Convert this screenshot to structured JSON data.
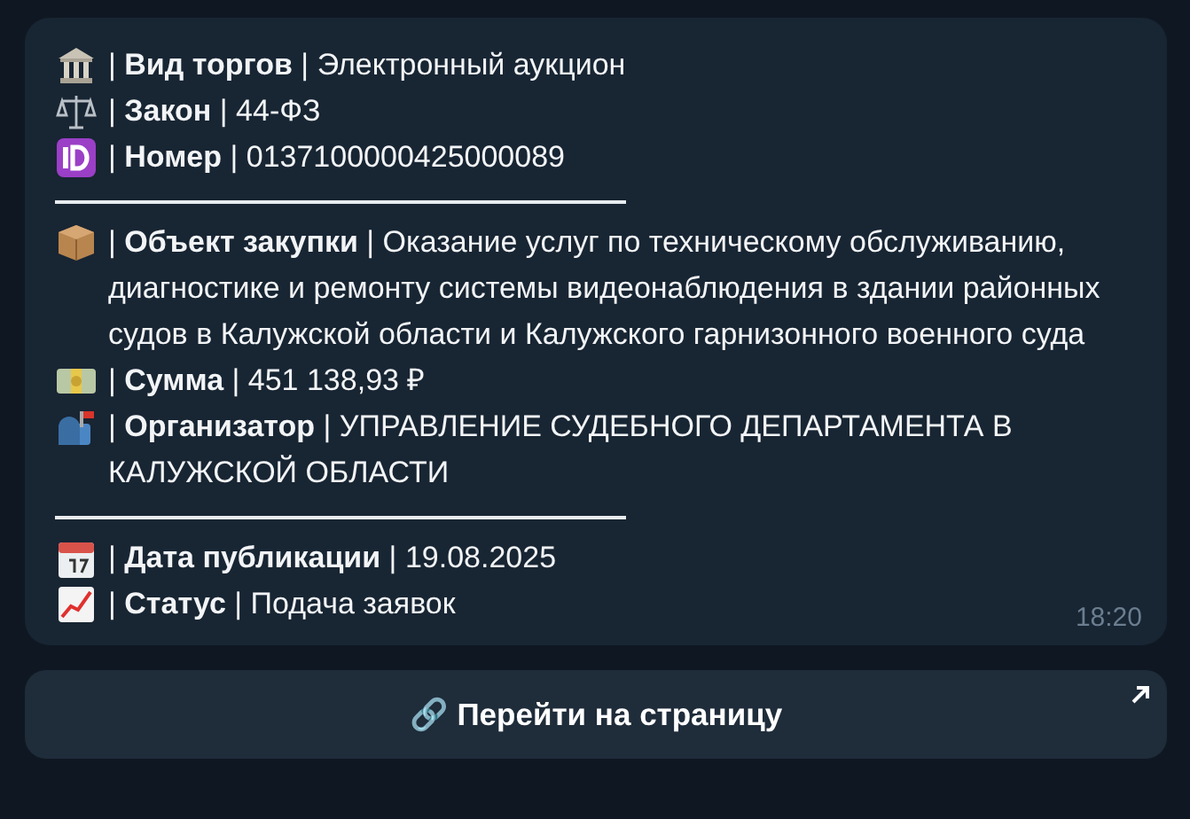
{
  "message": {
    "sections": [
      {
        "rows": [
          {
            "kind": "bank",
            "text": "| **Вид торгов** | Электронный аукцион"
          },
          {
            "kind": "scales",
            "text": "| **Закон** | 44-ФЗ"
          },
          {
            "kind": "id",
            "text": "| **Номер** | 0137100000425000089"
          }
        ]
      },
      {
        "rows": [
          {
            "kind": "package",
            "text": "| **Объект закупки** | Оказание услуг по техническому обслуживанию, диагностике и ремонту системы видеонаблюдения в здании районных судов в Калужской области и Калужского гарнизонного военного суда"
          },
          {
            "kind": "money",
            "text": "| **Сумма** | 451 138,93 ₽"
          },
          {
            "kind": "mailbox",
            "text": "| **Организатор** | УПРАВЛЕНИЕ СУДЕБНОГО ДЕПАРТАМЕНТА В КАЛУЖСКОЙ ОБЛАСТИ"
          }
        ]
      },
      {
        "rows": [
          {
            "kind": "calendar",
            "text": "| **Дата публикации** | 19.08.2025"
          },
          {
            "kind": "chart",
            "text": "| **Статус** | Подача заявок"
          }
        ]
      }
    ],
    "time": "18:20"
  },
  "button": {
    "label": "🔗 Перейти на страницу"
  }
}
